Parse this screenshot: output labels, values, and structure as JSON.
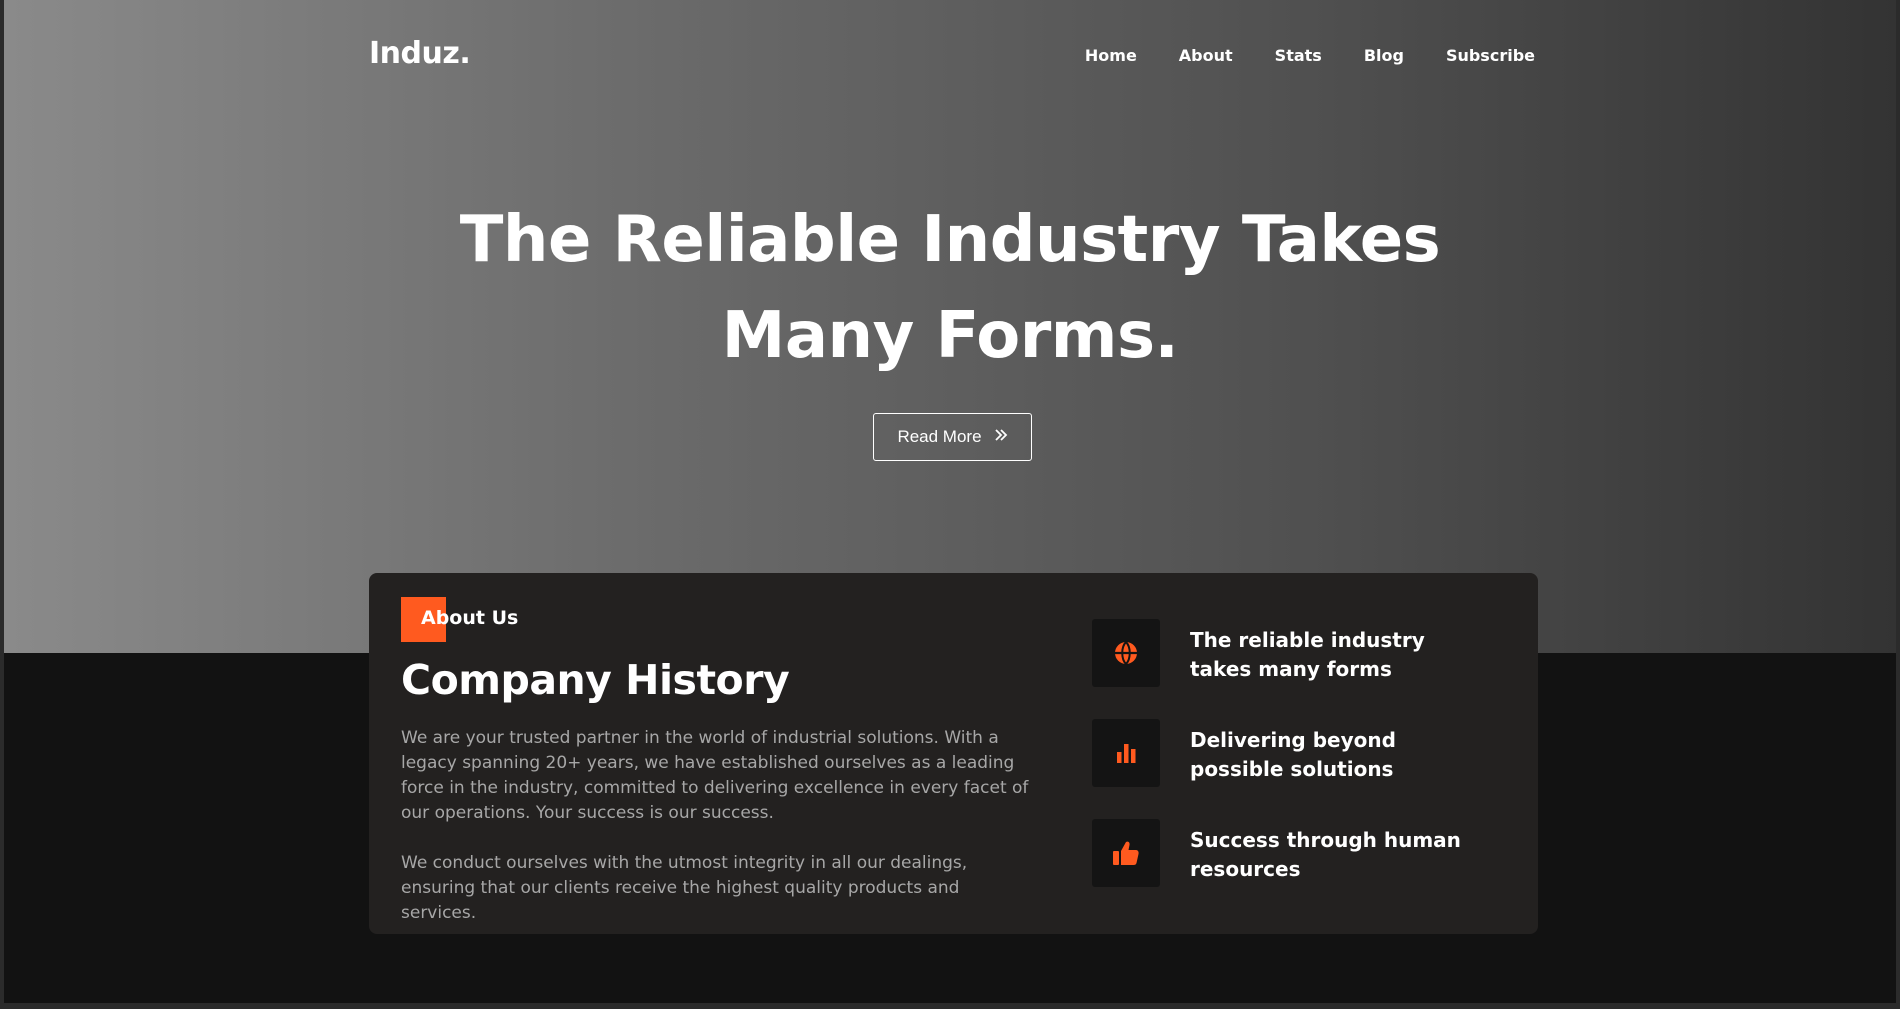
{
  "brand": {
    "logo": "Induz."
  },
  "nav": {
    "items": [
      {
        "label": "Home"
      },
      {
        "label": "About"
      },
      {
        "label": "Stats"
      },
      {
        "label": "Blog"
      },
      {
        "label": "Subscribe"
      }
    ]
  },
  "hero": {
    "headline_line1": "The Reliable Industry Takes",
    "headline_line2": "Many Forms.",
    "button_label": "Read More",
    "button_icon": "double-chevron-right-icon"
  },
  "about": {
    "tag": "About Us",
    "title": "Company History",
    "paragraph1": "We are your trusted partner in the world of industrial solutions. With a legacy spanning 20+ years, we have established ourselves as a leading force in the industry, committed to delivering excellence in every facet of our operations. Your success is our success.",
    "paragraph2": "We conduct ourselves with the utmost integrity in all our dealings, ensuring that our clients receive the highest quality products and services.",
    "features": [
      {
        "icon": "globe-icon",
        "text": "The reliable industry takes many forms"
      },
      {
        "icon": "bar-chart-icon",
        "text": "Delivering beyond possible solutions"
      },
      {
        "icon": "thumbs-up-icon",
        "text": "Success through human resources"
      }
    ]
  },
  "colors": {
    "accent": "#ff5a1f",
    "card_bg": "#232120",
    "page_bg": "#121212"
  }
}
